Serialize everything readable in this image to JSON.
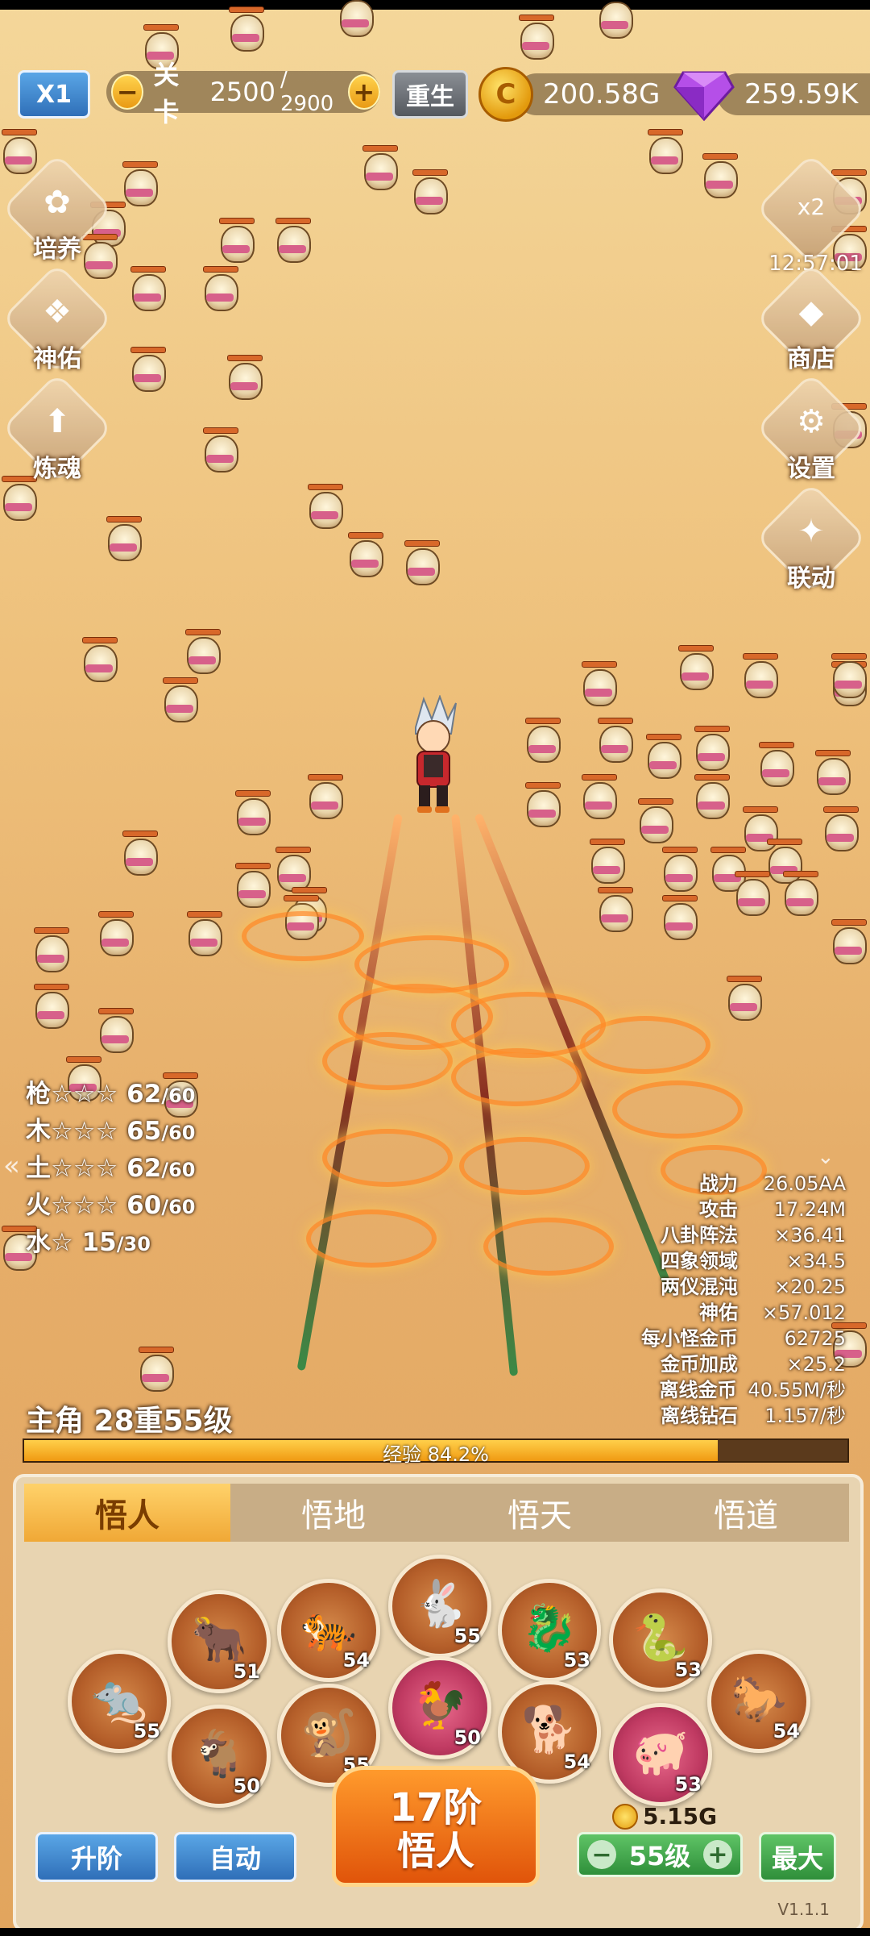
{
  "hud": {
    "speed_label": "X1",
    "stage_label": "关卡",
    "stage_current": "2500",
    "stage_max": "/ 2900",
    "rebirth_label": "重生",
    "gold": "200.58G",
    "gems": "259.59K",
    "minus": "−",
    "plus": "+",
    "coin_glyph": "C"
  },
  "side_left": [
    {
      "label": "培养",
      "icon": "cultivate-icon",
      "glyph": "✿"
    },
    {
      "label": "神佑",
      "icon": "blessing-icon",
      "glyph": "❖"
    },
    {
      "label": "炼魂",
      "icon": "soul-refine-icon",
      "glyph": "⬆"
    }
  ],
  "side_right": [
    {
      "label": "",
      "icon": "double-bag-icon",
      "glyph": "x2"
    },
    {
      "label": "商店",
      "icon": "shop-diamond-icon",
      "glyph": "◆"
    },
    {
      "label": "设置",
      "icon": "settings-gear-icon",
      "glyph": "⚙"
    },
    {
      "label": "联动",
      "icon": "collab-icon",
      "glyph": "✦"
    }
  ],
  "timer": "12:57:01",
  "weapons": [
    {
      "name": "枪",
      "stars": "☆☆☆",
      "cur": "62",
      "max": "/60"
    },
    {
      "name": "木",
      "stars": "☆☆☆",
      "cur": "65",
      "max": "/60"
    },
    {
      "name": "土",
      "stars": "☆☆☆",
      "cur": "62",
      "max": "/60"
    },
    {
      "name": "火",
      "stars": "☆☆☆",
      "cur": "60",
      "max": "/60"
    },
    {
      "name": "水",
      "stars": "☆",
      "cur": "15",
      "max": "/30"
    }
  ],
  "stats": [
    {
      "k": "战力",
      "v": "26.05AA"
    },
    {
      "k": "攻击",
      "v": "17.24M"
    },
    {
      "k": "八卦阵法",
      "v": "×36.41"
    },
    {
      "k": "四象领域",
      "v": "×34.5"
    },
    {
      "k": "两仪混沌",
      "v": "×20.25"
    },
    {
      "k": "神佑",
      "v": "×57.012"
    },
    {
      "k": "每小怪金币",
      "v": "62725"
    },
    {
      "k": "金币加成",
      "v": "×25.2"
    },
    {
      "k": "离线金币",
      "v": "40.55M/秒"
    },
    {
      "k": "离线钻石",
      "v": "1.157/秒"
    }
  ],
  "hero": {
    "level_text": "主角 28重55级",
    "xp_label": "经验 84.2%",
    "xp_fraction": 0.842
  },
  "tabs": [
    "悟人",
    "悟地",
    "悟天",
    "悟道"
  ],
  "active_tab": 0,
  "zodiac": [
    {
      "icon": "rat-icon",
      "glyph": "🐀",
      "level": "55",
      "pink": false
    },
    {
      "icon": "ox-icon",
      "glyph": "🐂",
      "level": "51",
      "pink": false
    },
    {
      "icon": "goat-icon",
      "glyph": "🐐",
      "level": "50",
      "pink": false
    },
    {
      "icon": "tiger-icon",
      "glyph": "🐅",
      "level": "54",
      "pink": false
    },
    {
      "icon": "monkey-icon",
      "glyph": "🐒",
      "level": "55",
      "pink": false
    },
    {
      "icon": "rabbit-icon",
      "glyph": "🐇",
      "level": "55",
      "pink": false
    },
    {
      "icon": "rooster-icon",
      "glyph": "🐓",
      "level": "50",
      "pink": true
    },
    {
      "icon": "dragon-icon",
      "glyph": "🐉",
      "level": "53",
      "pink": false
    },
    {
      "icon": "dog-icon",
      "glyph": "🐕",
      "level": "54",
      "pink": false
    },
    {
      "icon": "snake-icon",
      "glyph": "🐍",
      "level": "53",
      "pink": false
    },
    {
      "icon": "pig-icon",
      "glyph": "🐖",
      "level": "53",
      "pink": true
    },
    {
      "icon": "horse-icon",
      "glyph": "🐎",
      "level": "54",
      "pink": false
    }
  ],
  "controls": {
    "upgrade_tier": "17阶",
    "upgrade_name": "悟人",
    "rank_up": "升阶",
    "auto": "自动",
    "cost": "5.15G",
    "level_value": "55级",
    "max": "最大",
    "minus": "−",
    "plus": "+"
  },
  "version": "V1.1.1",
  "colors": {
    "sand": "#eec07b",
    "accent_orange": "#f09a12",
    "button_blue": "#2f6fb8",
    "button_green": "#2f8f3a",
    "gem_purple": "#a23be0"
  }
}
